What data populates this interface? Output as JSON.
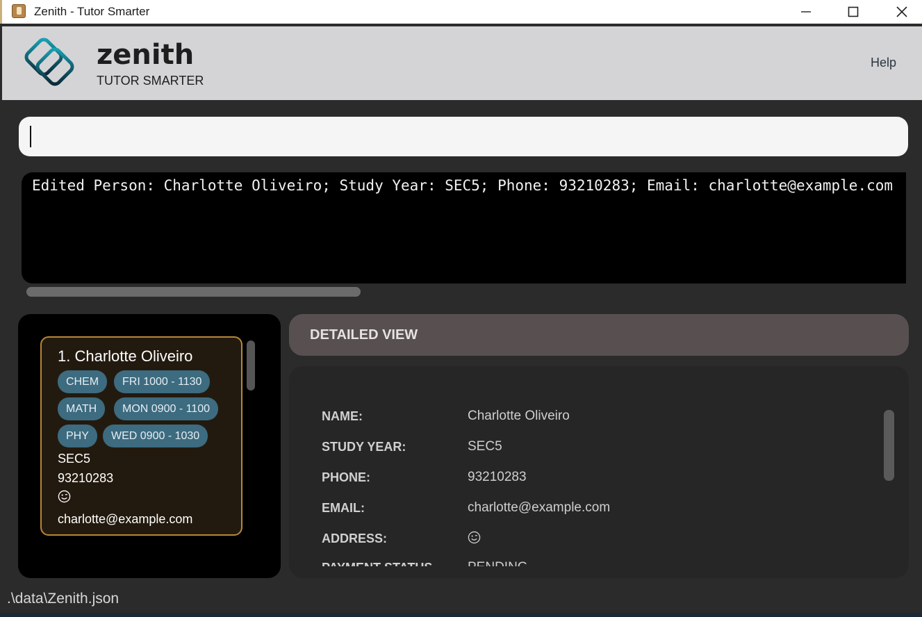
{
  "window": {
    "title": "Zenith - Tutor Smarter",
    "icon": "app-icon",
    "controls": [
      "minimize-icon",
      "maximize-icon",
      "close-icon"
    ]
  },
  "header": {
    "brand_name": "zenith",
    "tagline": "TUTOR SMARTER",
    "help_label": "Help"
  },
  "command_box": {
    "value": "",
    "placeholder": ""
  },
  "result_display": {
    "text": "Edited Person: Charlotte Oliveiro; Study Year: SEC5; Phone: 93210283; Email: charlotte@example.com"
  },
  "person_list": [
    {
      "title": "1. Charlotte Oliveiro",
      "subjects": [
        {
          "subject": "CHEM",
          "time": "FRI 1000 - 1130"
        },
        {
          "subject": "MATH",
          "time": "MON 0900 - 1100"
        },
        {
          "subject": "PHY",
          "time": "WED 0900 - 1030"
        }
      ],
      "study_year": "SEC5",
      "phone": "93210283",
      "address_icon": "smiley-icon",
      "email": "charlotte@example.com"
    }
  ],
  "detailed_view": {
    "header": "DETAILED VIEW",
    "fields": [
      {
        "label": "NAME:",
        "value": "Charlotte Oliveiro"
      },
      {
        "label": "STUDY YEAR:",
        "value": "SEC5"
      },
      {
        "label": "PHONE:",
        "value": "93210283"
      },
      {
        "label": "EMAIL:",
        "value": "charlotte@example.com"
      },
      {
        "label": "ADDRESS:",
        "value": "",
        "icon": "smiley-icon"
      },
      {
        "label": "PAYMENT STATUS",
        "value": "PENDING"
      }
    ]
  },
  "status_bar": {
    "file_path": ".\\data\\Zenith.json"
  },
  "colors": {
    "background": "#2b2b2b",
    "header_bg": "#d4d4d7",
    "card_border": "#b88838",
    "chip_bg": "#3d6b80",
    "detail_header_bg": "#585050"
  }
}
